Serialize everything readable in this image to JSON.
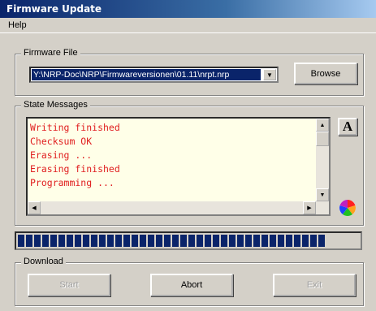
{
  "window": {
    "title": "Firmware Update"
  },
  "menu": {
    "help": "Help"
  },
  "firmware_file": {
    "legend": "Firmware File",
    "path": "Y:\\NRP-Doc\\NRP\\Firmwareversionen\\01.11\\nrpt.nrp",
    "browse_label": "Browse"
  },
  "state_messages": {
    "legend": "State Messages",
    "lines": [
      "Writing finished",
      "Checksum OK",
      "Erasing ...",
      "Erasing finished",
      "Programming ..."
    ],
    "text_color": "#e02020",
    "background": "#ffffe8",
    "font_button_label": "A"
  },
  "progress": {
    "fraction": 0.9,
    "color": "#0a246a"
  },
  "download": {
    "legend": "Download",
    "start_label": "Start",
    "abort_label": "Abort",
    "exit_label": "Exit"
  },
  "icons": {
    "font": "font-icon",
    "color": "color-wheel-icon",
    "dropdown": "chevron-down-icon"
  }
}
